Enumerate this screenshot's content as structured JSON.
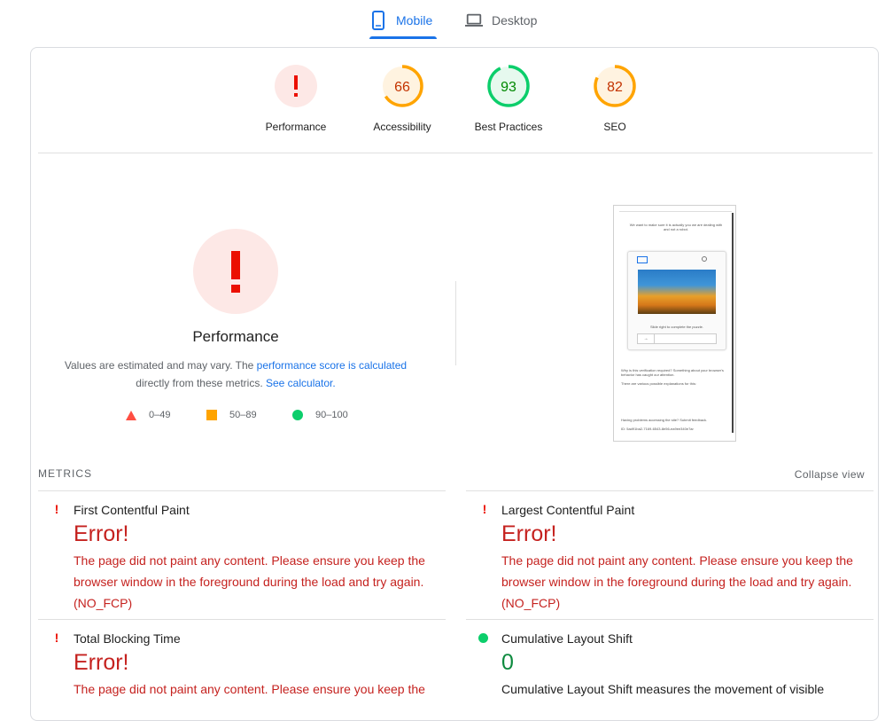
{
  "tabs": {
    "mobile": {
      "label": "Mobile",
      "icon": "phone-icon"
    },
    "desktop": {
      "label": "Desktop",
      "icon": "laptop-icon"
    }
  },
  "scores": [
    {
      "label": "Performance",
      "value": "!",
      "status": "error",
      "score": null
    },
    {
      "label": "Accessibility",
      "value": "66",
      "status": "average",
      "score": 66
    },
    {
      "label": "Best Practices",
      "value": "93",
      "status": "pass",
      "score": 93
    },
    {
      "label": "SEO",
      "value": "82",
      "status": "average",
      "score": 82
    }
  ],
  "performance": {
    "title": "Performance",
    "desc_prefix": "Values are estimated and may vary. The ",
    "desc_link": "performance score is calculated",
    "desc_middle": "directly from these metrics.",
    "calculator_link": "See calculator."
  },
  "legend": {
    "fail": "0–49",
    "average": "50–89",
    "pass": "90–100"
  },
  "screenshot": {
    "text_top": "We want to make sure it is actually you we are dealing with and not a robot.",
    "slide_text": "Slide right to complete the puzzle.",
    "why_text": "Why is this verification required? Something about your browser's behavior has caught our attention.",
    "explanations": "There are various possible explanations for this:",
    "footer": "Having problems accessing the site? Submit feedback.",
    "id": "ID: 5ad91ba2-7169-6543-8e56-ea9ee340e7ar"
  },
  "metrics_header": "METRICS",
  "collapse_label": "Collapse view",
  "metrics": [
    {
      "title": "First Contentful Paint",
      "value": "Error!",
      "status": "error",
      "desc": "The page did not paint any content. Please ensure you keep the browser window in the foreground during the load and try again. (NO_FCP)"
    },
    {
      "title": "Largest Contentful Paint",
      "value": "Error!",
      "status": "error",
      "desc": "The page did not paint any content. Please ensure you keep the browser window in the foreground during the load and try again. (NO_FCP)"
    },
    {
      "title": "Total Blocking Time",
      "value": "Error!",
      "status": "error",
      "desc": "The page did not paint any content. Please ensure you keep the"
    },
    {
      "title": "Cumulative Layout Shift",
      "value": "0",
      "status": "pass",
      "desc": "Cumulative Layout Shift measures the movement of visible"
    }
  ],
  "colors": {
    "accent": "#1a73e8",
    "fail": "#ff4e42",
    "average": "#ffa400",
    "pass": "#0cce6b",
    "error_text": "#c5221f"
  }
}
